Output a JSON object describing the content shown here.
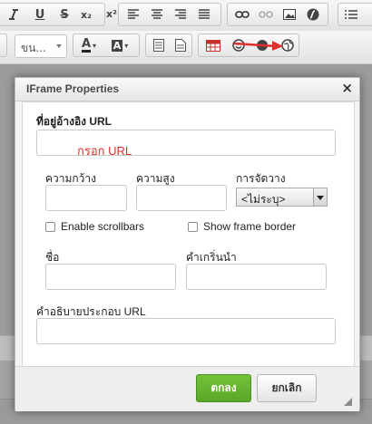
{
  "toolbar": {
    "row1": {
      "underline": "U",
      "strike": "S",
      "subscript": "x₂",
      "superscript": "x²"
    },
    "row2": {
      "size_combo": "ขน...",
      "text_color": "A",
      "bg_color": "A"
    }
  },
  "annotation": {
    "hint_text": "กรอก URL",
    "color": "#e0302b"
  },
  "dialog": {
    "title": "IFrame Properties",
    "close": "×",
    "url_label": "ที่อยู่อ้างอิง URL",
    "url_value": "",
    "width_label": "ความกว้าง",
    "height_label": "ความสูง",
    "align_label": "การจัดวาง",
    "align_value": "<ไม่ระบุ>",
    "scrollbars_label": "Enable scrollbars",
    "frameborder_label": "Show frame border",
    "name_label": "ชื่อ",
    "title_field_label": "คำเกริ่นนำ",
    "longdesc_label": "คำอธิบายประกอบ URL",
    "ok_button": "ตกลง",
    "cancel_button": "ยกเลิก"
  },
  "icons": [
    "bold-icon",
    "italic-icon",
    "underline-icon",
    "strike-icon",
    "subscript-icon",
    "superscript-icon",
    "align-left-icon",
    "align-center-icon",
    "align-right-icon",
    "align-justify-icon",
    "link-icon",
    "unlink-icon",
    "image-icon",
    "flash-icon",
    "list-icon",
    "source-icon",
    "document-icon",
    "table-icon",
    "smiley-icon",
    "special-char-icon",
    "iframe-icon",
    "red-arrow-icon"
  ],
  "colors": {
    "ok_green": "#5aa627",
    "annotation_red": "#e0302b",
    "table_icon_red": "#c4302b"
  }
}
